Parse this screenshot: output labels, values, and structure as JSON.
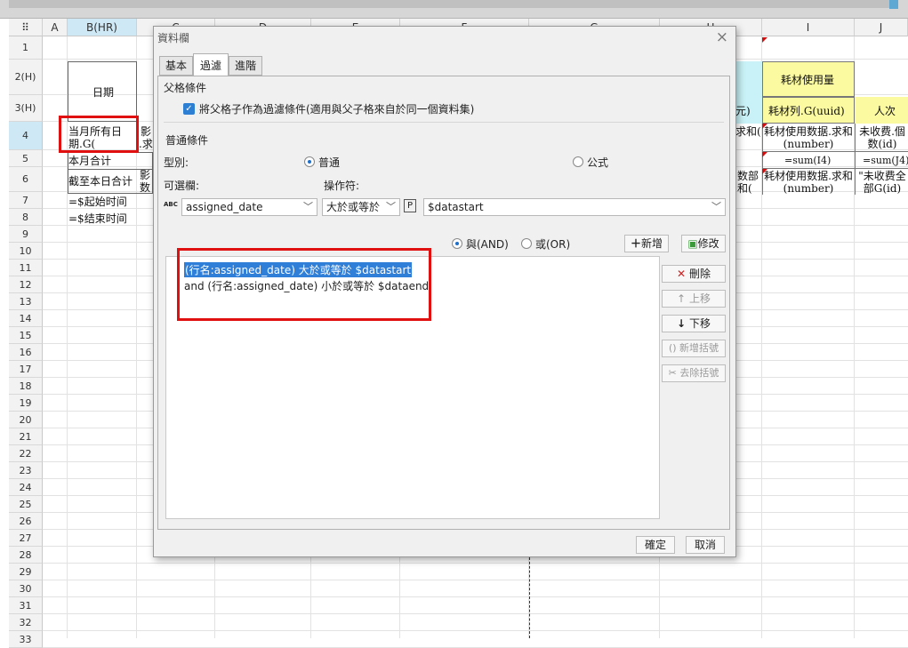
{
  "sheet": {
    "columns": [
      "A",
      "B(HR)",
      "C",
      "D",
      "E",
      "F",
      "G",
      "H",
      "I",
      "J"
    ],
    "rows": [
      "1",
      "2(H)",
      "3(H)",
      "4",
      "5",
      "6",
      "7",
      "8",
      "9",
      "10",
      "11",
      "12",
      "13",
      "14",
      "15",
      "16",
      "17",
      "18",
      "19",
      "20",
      "21",
      "22",
      "23",
      "24",
      "25",
      "26",
      "27",
      "28",
      "29",
      "30",
      "31",
      "32",
      "33"
    ],
    "cells": {
      "date_header": "日期",
      "c2_frag": "影",
      "c2_frag2": ".求",
      "month_all_dates": "当月所有日期.G(",
      "month_total": "本月合计",
      "to_date_total": "截至本日合计",
      "c6_frag": "影\n数",
      "start_time": "=$起始时间",
      "end_time": "=$结束时间",
      "h3": "元)",
      "h4": "求和(",
      "h6": "数部\n和(",
      "consumable_usage": "耗材使用量",
      "consumable_col": "耗材列.G(uuid)",
      "consumable_sum": "耗材使用数据.求和(number)",
      "sum_i4": "=sum(I4)",
      "consumable_sum2": "耗材使用数据.求和(number)",
      "headcount": "人次",
      "unpaid_count": "未收费.個数(id)",
      "sum_j4": "=sum(J4)",
      "unpaid_all": "\"未收费全部G(id)"
    }
  },
  "dialog": {
    "title": "資料欄",
    "close": "×",
    "tabs": [
      "基本",
      "過濾",
      "進階"
    ],
    "parent_section": "父格條件",
    "parent_checkbox_label": "將父格子作為過濾條件(適用與父子格來自於同一個資料集)",
    "normal_section": "普通條件",
    "type_label": "型別:",
    "type_options": [
      "普通",
      "公式"
    ],
    "selectable_label": "可選欄:",
    "operator_label": "操作符:",
    "column_value": "assigned_date",
    "column_icon_text": "ABC",
    "operator_value": "大於或等於",
    "param_icon": "P",
    "param_value": "$datastart",
    "logic_and": "與(AND)",
    "logic_or": "或(OR)",
    "add_button": "新增",
    "modify_button": "修改",
    "conditions": [
      "(行名:assigned_date) 大於或等於 $datastart",
      "and (行名:assigned_date) 小於或等於 $dataend"
    ],
    "side_buttons": [
      "刪除",
      "上移",
      "下移",
      "新增括號",
      "去除括號"
    ],
    "ok": "確定",
    "cancel": "取消"
  }
}
